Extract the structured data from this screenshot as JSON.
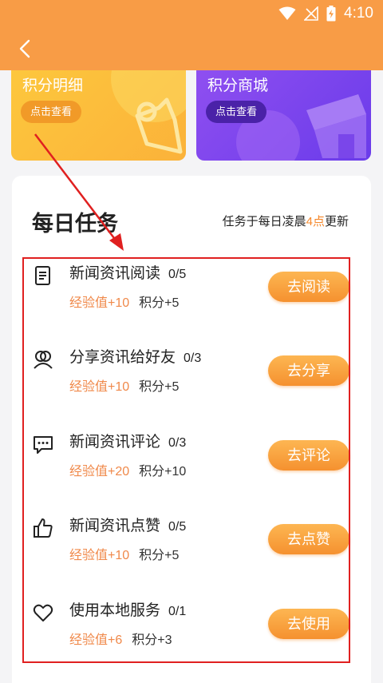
{
  "status_bar": {
    "time": "4:10"
  },
  "cards": [
    {
      "title": "积分明细",
      "button": "点击查看"
    },
    {
      "title": "积分商城",
      "button": "点击查看"
    }
  ],
  "daily": {
    "title": "每日任务",
    "note_prefix": "任务于每日凌晨",
    "note_highlight": "4点",
    "note_suffix": "更新"
  },
  "tasks": [
    {
      "name": "新闻资讯阅读",
      "progress": "0/5",
      "exp": "经验值+10",
      "points": "积分+5",
      "button": "去阅读",
      "icon": "document-icon"
    },
    {
      "name": "分享资讯给好友",
      "progress": "0/3",
      "exp": "经验值+10",
      "points": "积分+5",
      "button": "去分享",
      "icon": "share-users-icon"
    },
    {
      "name": "新闻资讯评论",
      "progress": "0/3",
      "exp": "经验值+20",
      "points": "积分+10",
      "button": "去评论",
      "icon": "comment-icon"
    },
    {
      "name": "新闻资讯点赞",
      "progress": "0/5",
      "exp": "经验值+10",
      "points": "积分+5",
      "button": "去点赞",
      "icon": "thumbs-up-icon"
    },
    {
      "name": "使用本地服务",
      "progress": "0/1",
      "exp": "经验值+6",
      "points": "积分+3",
      "button": "去使用",
      "icon": "heart-icon"
    }
  ],
  "colors": {
    "header": "#f89c46",
    "accent": "#f5872a",
    "annotation": "#e02020"
  }
}
